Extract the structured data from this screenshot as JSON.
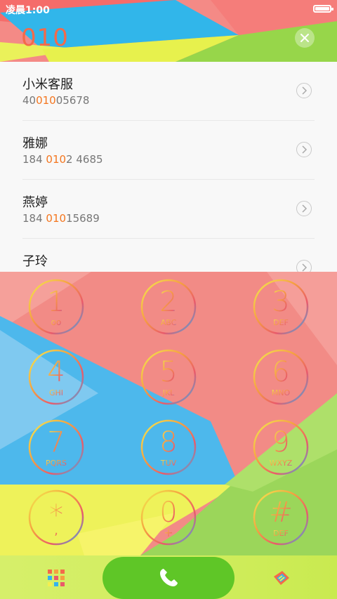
{
  "status_bar": {
    "time": "凌晨1:00"
  },
  "dialer": {
    "input": "010"
  },
  "results": [
    {
      "name": "小米客服",
      "num_pre": "40",
      "num_hl": "010",
      "num_post": "05678"
    },
    {
      "name": "雅娜",
      "num_pre": "184 ",
      "num_hl": "010",
      "num_post": "2 4685"
    },
    {
      "name": "燕婷",
      "num_pre": "184 ",
      "num_hl": "010",
      "num_post": "15689"
    },
    {
      "name": "子玲",
      "num_pre": "",
      "num_hl": "",
      "num_post": ""
    }
  ],
  "keys": [
    {
      "digit": "1",
      "letters": ""
    },
    {
      "digit": "2",
      "letters": "ABC"
    },
    {
      "digit": "3",
      "letters": "DEF"
    },
    {
      "digit": "4",
      "letters": "GHI"
    },
    {
      "digit": "5",
      "letters": "JKL"
    },
    {
      "digit": "6",
      "letters": "MNO"
    },
    {
      "digit": "7",
      "letters": "PQRS"
    },
    {
      "digit": "8",
      "letters": "TUV"
    },
    {
      "digit": "9",
      "letters": "WXYZ"
    },
    {
      "digit": "*",
      "letters": ","
    },
    {
      "digit": "0",
      "letters": "+"
    },
    {
      "digit": "#",
      "letters": "DEF"
    }
  ],
  "colors": {
    "accent": "#f4761f",
    "call": "#5fc627",
    "digits": "#f46a4a"
  }
}
